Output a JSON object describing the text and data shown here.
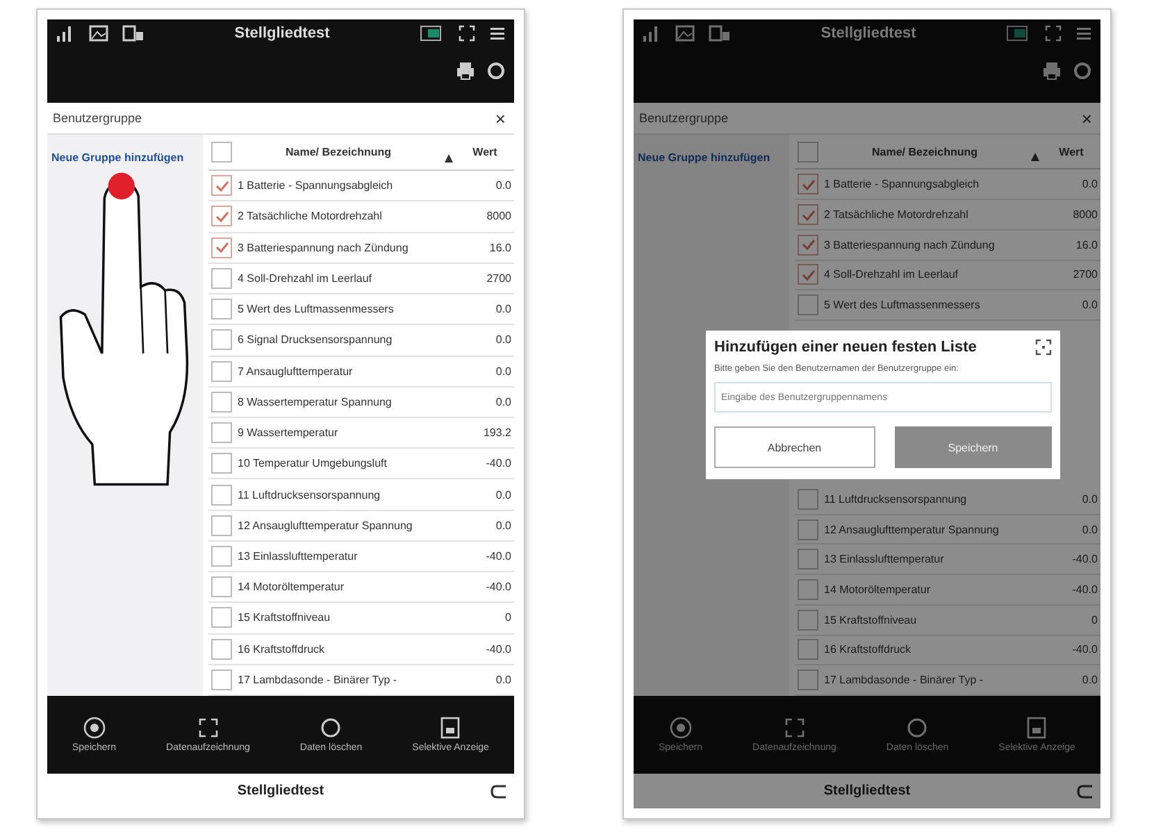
{
  "screens": [
    {
      "kind": "annotated",
      "title": "Stellgliedtest",
      "group_header": "Benutzergruppe",
      "close": "×",
      "add_group": "Neue Gruppe hinzufügen",
      "columns": [
        "Name/ Bezeichnung",
        "Wert"
      ],
      "select_all": false,
      "rows": [
        {
          "name": "1 Batterie - Spannungsabgleich",
          "value": "0.0",
          "checked": true
        },
        {
          "name": "2 Tatsächliche Motordrehzahl",
          "value": "8000",
          "checked": true
        },
        {
          "name": "3 Batteriespannung nach Zündung",
          "value": "16.0",
          "checked": true
        },
        {
          "name": "4 Soll-Drehzahl im Leerlauf",
          "value": "2700",
          "checked": false
        },
        {
          "name": "5 Wert des Luftmassenmessers",
          "value": "0.0",
          "checked": false
        },
        {
          "name": "6 Signal Drucksensorspannung",
          "value": "0.0",
          "checked": false
        },
        {
          "name": "7 Ansauglufttemperatur",
          "value": "0.0",
          "checked": false
        },
        {
          "name": "8 Wassertemperatur Spannung",
          "value": "0.0",
          "checked": false
        },
        {
          "name": "9 Wassertemperatur",
          "value": "193.2",
          "checked": false
        },
        {
          "name": "10 Temperatur Umgebungsluft",
          "value": "-40.0",
          "checked": false
        },
        {
          "name": "11 Luftdrucksensorspannung",
          "value": "0.0",
          "checked": false
        },
        {
          "name": "12 Ansauglufttemperatur Spannung",
          "value": "0.0",
          "checked": false
        },
        {
          "name": "13 Einlasslufttemperatur",
          "value": "-40.0",
          "checked": false
        },
        {
          "name": "14 Motoröltemperatur",
          "value": "-40.0",
          "checked": false
        },
        {
          "name": "15 Kraftstoffniveau",
          "value": "0",
          "checked": false
        },
        {
          "name": "16 Kraftstoffdruck",
          "value": "-40.0",
          "checked": false
        },
        {
          "name": "17 Lambdasonde - Binärer Typ -",
          "value": "0.0",
          "checked": false
        }
      ],
      "toolbar": [
        "Speichern",
        "Datenaufzeichnung",
        "Daten löschen",
        "Selektive Anzeige"
      ],
      "footer": "Stellgliedtest"
    },
    {
      "kind": "dialog",
      "title": "Stellgliedtest",
      "group_header": "Benutzergruppe",
      "close": "×",
      "add_group": "Neue Gruppe hinzufügen",
      "columns": [
        "Name/ Bezeichnung",
        "Wert"
      ],
      "select_all": false,
      "rows_above": [
        {
          "name": "1 Batterie - Spannungsabgleich",
          "value": "0.0",
          "checked": true
        },
        {
          "name": "2 Tatsächliche Motordrehzahl",
          "value": "8000",
          "checked": true
        },
        {
          "name": "3 Batteriespannung nach Zündung",
          "value": "16.0",
          "checked": true
        },
        {
          "name": "4 Soll-Drehzahl im Leerlauf",
          "value": "2700",
          "checked": true
        },
        {
          "name": "5 Wert des Luftmassenmessers",
          "value": "0.0",
          "checked": false
        }
      ],
      "rows_below": [
        {
          "name": "11 Luftdrucksensorspannung",
          "value": "0.0",
          "checked": false
        },
        {
          "name": "12 Ansauglufttemperatur Spannung",
          "value": "0.0",
          "checked": false
        },
        {
          "name": "13 Einlasslufttemperatur",
          "value": "-40.0",
          "checked": false
        },
        {
          "name": "14 Motoröltemperatur",
          "value": "-40.0",
          "checked": false
        },
        {
          "name": "15 Kraftstoffniveau",
          "value": "0",
          "checked": false
        },
        {
          "name": "16 Kraftstoffdruck",
          "value": "-40.0",
          "checked": false
        },
        {
          "name": "17 Lambdasonde - Binärer Typ -",
          "value": "0.0",
          "checked": false
        }
      ],
      "dialog": {
        "title": "Hinzufügen einer neuen festen Liste",
        "prompt": "Bitte geben Sie den Benutzernamen der Benutzergruppe ein:",
        "placeholder": "Eingabe des Benutzergruppennamens",
        "buttons": [
          "Abbrechen",
          "Speichern"
        ]
      },
      "toolbar": [
        "Speichern",
        "Datenaufzeichnung",
        "Daten löschen",
        "Selektive Anzeige"
      ],
      "footer": "Stellgliedtest"
    }
  ]
}
